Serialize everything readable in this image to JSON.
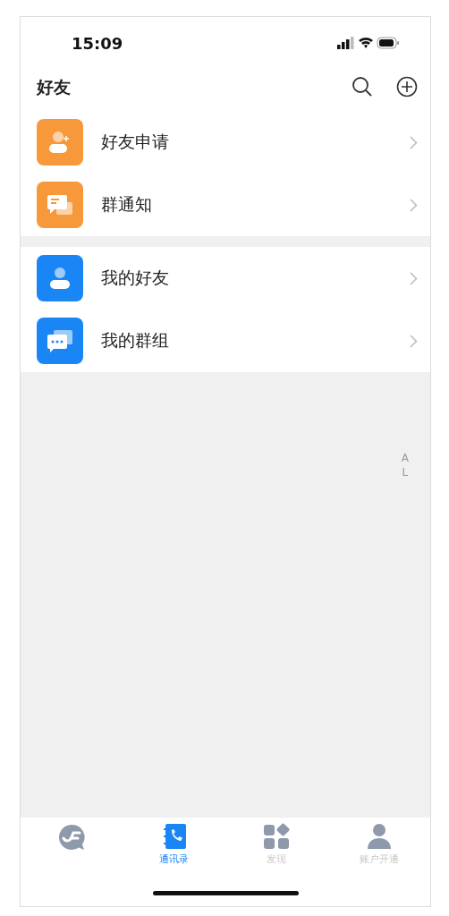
{
  "status_bar": {
    "time": "15:09"
  },
  "header": {
    "title": "好友"
  },
  "groups": [
    [
      {
        "kind": "friend-request",
        "label": "好友申请"
      },
      {
        "kind": "group-notice",
        "label": "群通知"
      }
    ],
    [
      {
        "kind": "my-friends",
        "label": "我的好友"
      },
      {
        "kind": "my-groups",
        "label": "我的群组"
      }
    ]
  ],
  "index_letters": [
    "A",
    "L"
  ],
  "tabs": [
    {
      "kind": "chat",
      "selected": false
    },
    {
      "kind": "contacts",
      "label": "通讯录",
      "selected": true
    },
    {
      "kind": "discover",
      "label": "发现",
      "selected": false
    },
    {
      "kind": "account",
      "label": "账户开通",
      "selected": false
    }
  ]
}
